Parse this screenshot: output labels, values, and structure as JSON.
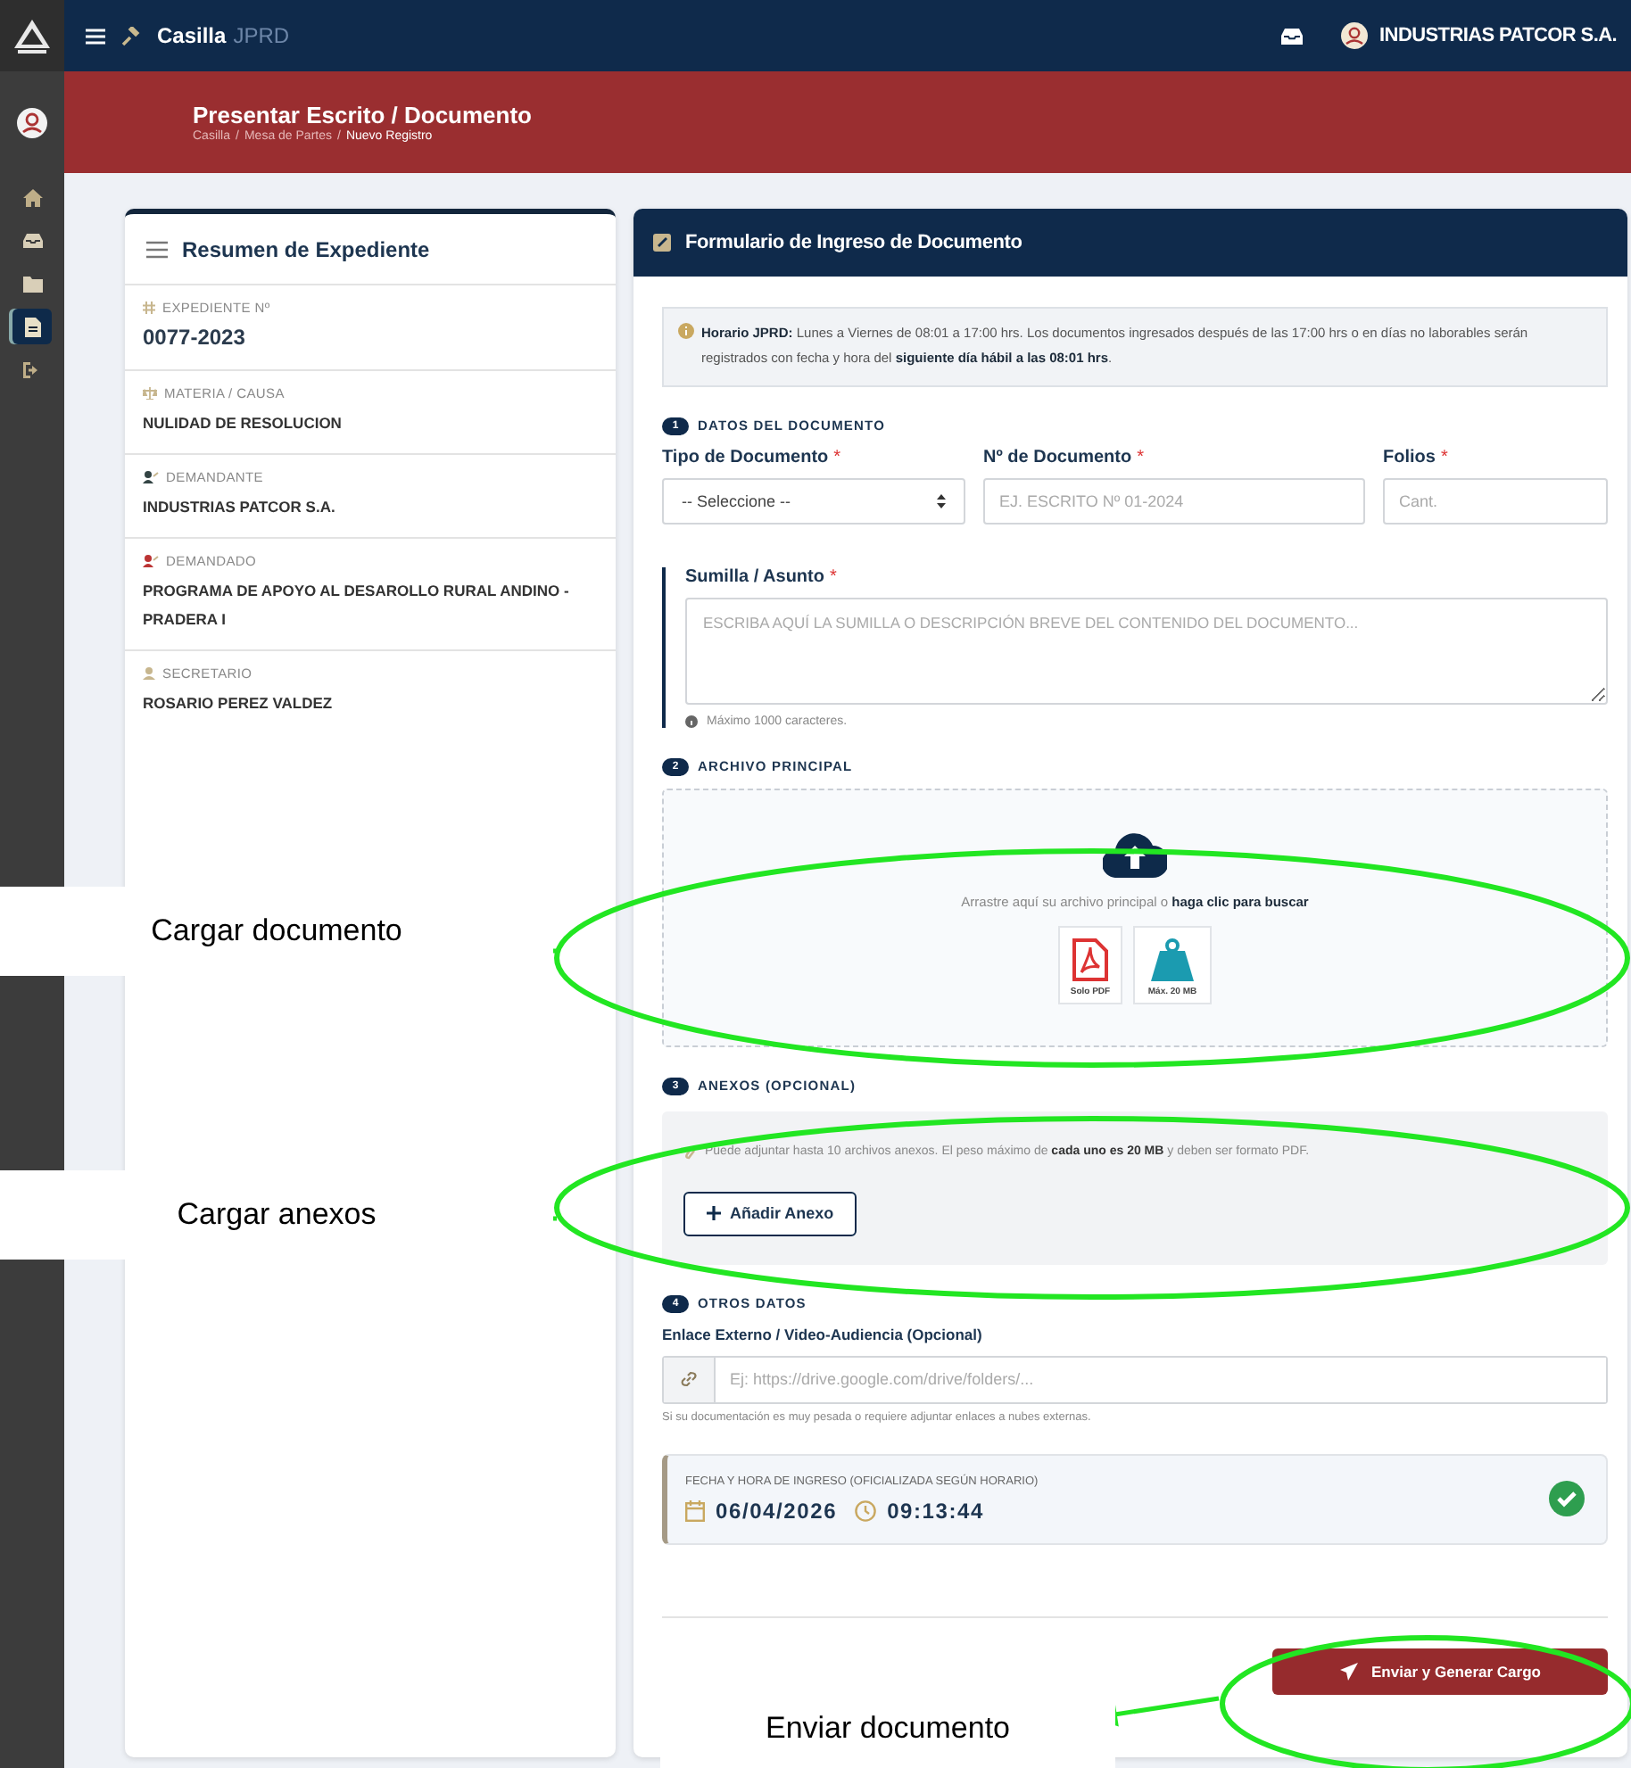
{
  "sidebar": {
    "items": [
      {
        "kind": "home",
        "selected": false
      },
      {
        "kind": "inbox",
        "selected": false
      },
      {
        "kind": "folder",
        "selected": false
      },
      {
        "kind": "file",
        "selected": true
      },
      {
        "kind": "logout",
        "selected": false
      }
    ]
  },
  "topbar": {
    "app": "Casilla",
    "app_suffix": "JPRD",
    "user": "INDUSTRIAS PATCOR S.A."
  },
  "banner": {
    "title": "Presentar Escrito / Documento",
    "breadcrumb": [
      {
        "kind": "link",
        "text": "Casilla"
      },
      {
        "kind": "separator",
        "text": "/"
      },
      {
        "kind": "link",
        "text": "Mesa de Partes"
      },
      {
        "kind": "separator",
        "text": "/"
      },
      {
        "kind": "current",
        "text": "Nuevo Registro"
      }
    ]
  },
  "summary": {
    "title": "Resumen de Expediente",
    "items": [
      {
        "kind": "hash",
        "label": "EXPEDIENTE Nº",
        "value": "0077-2023",
        "large": true
      },
      {
        "kind": "scale",
        "label": "MATERIA / CAUSA",
        "value": "NULIDAD DE RESOLUCION",
        "large": false
      },
      {
        "kind": "user",
        "label": "DEMANDANTE",
        "value": "INDUSTRIAS PATCOR S.A.",
        "large": false
      },
      {
        "kind": "user-red",
        "label": "DEMANDADO",
        "value": "PROGRAMA DE APOYO AL DESAROLLO RURAL ANDINO - PRADERA I",
        "large": false
      },
      {
        "kind": "person",
        "label": "SECRETARIO",
        "value": "ROSARIO PEREZ VALDEZ",
        "large": false
      }
    ]
  },
  "form": {
    "title": "Formulario de Ingreso de Documento",
    "notice": "**Horario JPRD:** Lunes a Viernes de 08:01 a 17:00 hrs. Los documentos ingresados después de las 17:00 hrs o en días no laborables serán registrados con fecha y hora del **siguiente día hábil a las 08:01 hrs**.",
    "sections": [
      {
        "number": "1",
        "title": "DATOS DEL DOCUMENTO"
      },
      {
        "number": "2",
        "title": "ARCHIVO PRINCIPAL"
      },
      {
        "number": "3",
        "title": "ANEXOS (OPCIONAL)"
      },
      {
        "number": "4",
        "title": "OTROS DATOS"
      }
    ],
    "fields": [
      {
        "kind": "select",
        "label": "Tipo de Documento",
        "required": "*",
        "value": "-- Seleccione --"
      },
      {
        "kind": "text",
        "label": "Nº de Documento",
        "required": "*",
        "placeholder": "EJ. ESCRITO Nº 01-2024"
      },
      {
        "kind": "text",
        "label": "Folios",
        "required": "*",
        "placeholder": "Cant."
      }
    ],
    "sumilla": {
      "label": "Sumilla / Asunto",
      "required": "*",
      "placeholder": "ESCRIBA AQUÍ LA SUMILLA O DESCRIPCIÓN BREVE DEL CONTENIDO DEL DOCUMENTO...",
      "hint": "Máximo 1000 caracteres."
    },
    "dropzone": {
      "text": "Arrastre aquí su archivo principal o **haga clic para buscar**",
      "badges": [
        {
          "kind": "pdf",
          "label": "Solo PDF"
        },
        {
          "kind": "weight",
          "label": "Máx. 20 MB"
        }
      ]
    },
    "annexes": {
      "note": "Puede adjuntar hasta 10 archivos anexos. El peso máximo de **cada uno es 20 MB** y deben ser formato PDF.",
      "button": "Añadir Anexo"
    },
    "link": {
      "label": "Enlace Externo / Video-Audiencia (Opcional)",
      "placeholder": "Ej: https://drive.google.com/drive/folders/...",
      "hint": "Si su documentación es muy pesada o requiere adjuntar enlaces a nubes externas."
    },
    "timestamp": {
      "label": "FECHA Y HORA DE INGRESO (OFICIALIZADA SEGÚN HORARIO)",
      "date": "06/04/2026",
      "time": "09:13:44",
      "verified": true
    },
    "submit": "Enviar y Generar Cargo"
  },
  "annotations": [
    {
      "label": "Cargar documento"
    },
    {
      "label": "Cargar anexos"
    },
    {
      "label": "Enviar documento"
    }
  ]
}
